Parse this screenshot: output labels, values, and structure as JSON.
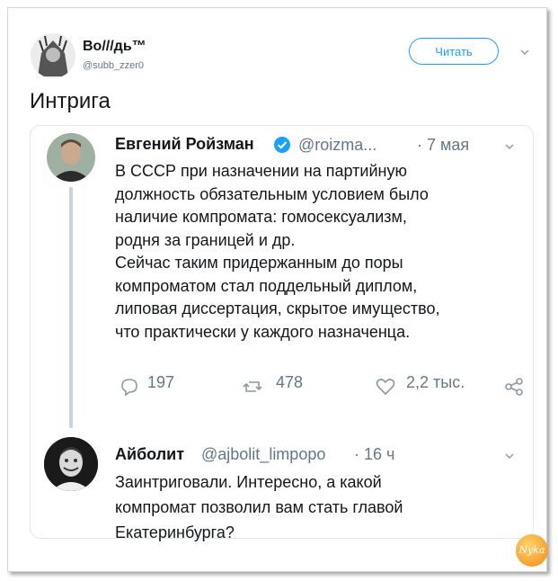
{
  "tweet": {
    "author_name": "Во///дь™",
    "author_handle": "@subb_zzer0",
    "follow_label": "Читать",
    "text": "Интрига"
  },
  "quoted": {
    "name": "Евгений Ройзман",
    "handle": "@roizma...",
    "time": "· 7 мая",
    "lines": [
      "В СССР при назначении на партийную",
      "должность обязательным условием было",
      "наличие компромата: гомосексуализм,",
      "родня за границей и др.",
      "Сейчас таким придержанным до поры",
      "компроматом стал поддельный диплом,",
      "липовая диссертация, скрытое имущество,",
      "что практически у каждого назначенца."
    ],
    "replies": "197",
    "retweets": "478",
    "likes": "2,2 тыс."
  },
  "reply": {
    "name": "Айболит",
    "handle": "@ajbolit_limpopo",
    "time": "· 16 ч",
    "lines": [
      "Заинтриговали. Интересно, а какой",
      "компромат позволил вам стать главой",
      "Екатеринбурга?"
    ]
  },
  "watermark": "Nyka",
  "colors": {
    "accent": "#1da1f2",
    "muted": "#657786",
    "text": "#14171a"
  }
}
